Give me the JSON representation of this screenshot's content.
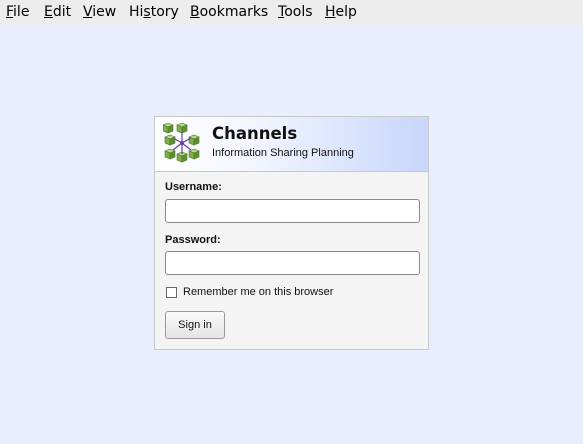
{
  "menubar": {
    "items": [
      {
        "accel": "F",
        "rest": "ile"
      },
      {
        "accel": "E",
        "rest": "dit"
      },
      {
        "accel": "V",
        "rest": "iew"
      },
      {
        "pre": "Hi",
        "accel": "s",
        "rest": "tory"
      },
      {
        "accel": "B",
        "rest": "ookmarks"
      },
      {
        "accel": "T",
        "rest": "ools"
      },
      {
        "accel": "H",
        "rest": "elp"
      }
    ]
  },
  "login": {
    "app_title": "Channels",
    "app_subtitle": "Information Sharing Planning",
    "logo_icon": "channels-cube-cluster-icon",
    "username_label": "Username:",
    "username_value": "",
    "password_label": "Password:",
    "password_value": "",
    "remember_label": "Remember me on this browser",
    "remember_checked": false,
    "sign_in_label": "Sign in"
  },
  "colors": {
    "page_background": "#e8eefe",
    "menubar_background": "#ededed",
    "header_gradient_end": "#c7d6fb",
    "panel_background": "#f4f4f4",
    "logo_green": "#7dae4a",
    "logo_purple": "#6b3fa0"
  }
}
